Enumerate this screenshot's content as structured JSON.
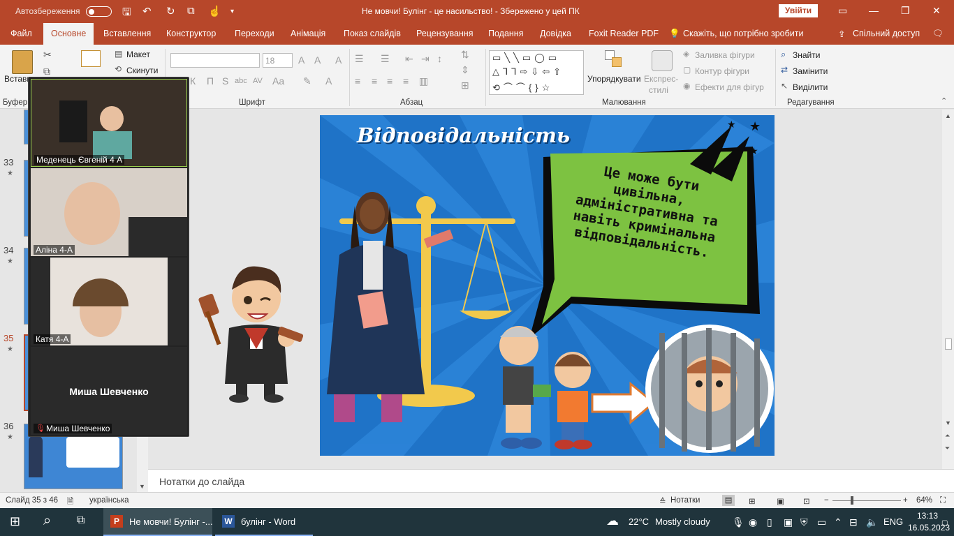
{
  "titlebar": {
    "autosave_label": "Автозбереження",
    "document_title": "Не мовчи! Булінг - це насильство!  -  Збережено у цей ПК",
    "signin_label": "Увійти"
  },
  "ribbon_tabs": [
    "Файл",
    "Основне",
    "Вставлення",
    "Конструктор",
    "Переходи",
    "Анімація",
    "Показ слайдів",
    "Рецензування",
    "Подання",
    "Довідка",
    "Foxit Reader PDF"
  ],
  "tell_me": "Скажіть, що потрібно зробити",
  "share_label": "Спільний доступ",
  "ribbon": {
    "paste_label": "Встави",
    "clipboard_group": "Буфер",
    "layout_label": "Макет",
    "reset_label": "Скинути",
    "font_size": "18",
    "font_group": "Шрифт",
    "paragraph_group": "Абзац",
    "arrange_label": "Упорядкувати",
    "quick_styles_line1": "Експрес-",
    "quick_styles_line2": "стилі",
    "shape_fill_label": "Заливка фігури",
    "shape_outline_label": "Контур фігури",
    "shape_effects_label": "Ефекти для фігур",
    "drawing_group": "Малювання",
    "find_label": "Знайти",
    "replace_label": "Замінити",
    "select_label": "Виділити",
    "editing_group": "Редагування"
  },
  "slide_numbers": [
    "33",
    "34",
    "35",
    "36"
  ],
  "zoom_participants": [
    "Меденець Євгеній 4 А",
    "Аліна 4-А",
    "Катя  4-А",
    "Миша Шевченко"
  ],
  "zoom_center_name": "Миша Шевченко",
  "slide": {
    "title": "Відповідальність",
    "bubble_text": "Це може бути цивільна, адміністративна та навіть кримінальна відповідальність."
  },
  "notes_placeholder": "Нотатки до слайда",
  "status": {
    "slide_info": "Слайд 35 з 46",
    "language": "українська",
    "notes_button": "Нотатки",
    "zoom_level": "64%"
  },
  "taskbar": {
    "ppt_window": "Не мовчи! Булінг -...",
    "word_window": "булінг - Word",
    "weather_temp": "22°C",
    "weather_desc": "Mostly cloudy",
    "lang": "ENG",
    "time": "13:13",
    "date": "16.05.2023"
  },
  "colors": {
    "accent": "#b7472a",
    "slide_bg": "#1f73c7",
    "bubble_green": "#7dc241",
    "taskbar": "#20343c"
  }
}
